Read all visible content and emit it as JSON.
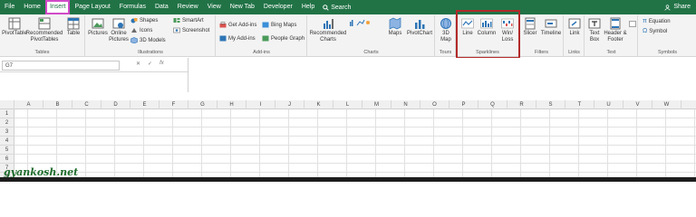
{
  "menu": {
    "items": [
      "File",
      "Home",
      "Insert",
      "Page Layout",
      "Formulas",
      "Data",
      "Review",
      "View",
      "New Tab",
      "Developer",
      "Help"
    ],
    "active_index": 2,
    "search_label": "Search",
    "share_label": "Share"
  },
  "ribbon": {
    "groups": {
      "tables": "Tables",
      "illustrations": "Illustrations",
      "addins": "Add-ins",
      "charts": "Charts",
      "tours": "Tours",
      "sparklines": "Sparklines",
      "filters": "Filters",
      "links": "Links",
      "text": "Text",
      "symbols": "Symbols"
    },
    "buttons": {
      "pivottable": "PivotTable",
      "recommended_pivottables": "Recommended PivotTables",
      "table": "Table",
      "pictures": "Pictures",
      "online_pictures": "Online Pictures",
      "shapes": "Shapes",
      "icons": "Icons",
      "models_3d": "3D Models",
      "smartart": "SmartArt",
      "screenshot": "Screenshot",
      "get_addins": "Get Add-ins",
      "my_addins": "My Add-ins",
      "bing_maps": "Bing Maps",
      "people_graph": "People Graph",
      "recommended_charts": "Recommended Charts",
      "maps": "Maps",
      "pivotchart": "PivotChart",
      "map_3d": "3D Map",
      "line": "Line",
      "column": "Column",
      "win_loss": "Win/ Loss",
      "slicer": "Slicer",
      "timeline": "Timeline",
      "link": "Link",
      "text_box": "Text Box",
      "header_footer": "Header & Footer",
      "equation": "Equation",
      "symbol": "Symbol"
    }
  },
  "formula_bar": {
    "name_box": "G7",
    "fx_label": "fx",
    "value": ""
  },
  "grid": {
    "columns": [
      "A",
      "B",
      "C",
      "D",
      "E",
      "F",
      "G",
      "H",
      "I",
      "J",
      "K",
      "L",
      "M",
      "N",
      "O",
      "P",
      "Q",
      "R",
      "S",
      "T",
      "U",
      "V",
      "W"
    ],
    "rows": [
      "1",
      "2",
      "3",
      "4",
      "5",
      "6",
      "7",
      "8"
    ]
  },
  "watermark": "gyankosh.net",
  "colors": {
    "accent": "#217346",
    "highlight_insert": "#d14ac8",
    "highlight_sparklines": "#b22a2a"
  }
}
